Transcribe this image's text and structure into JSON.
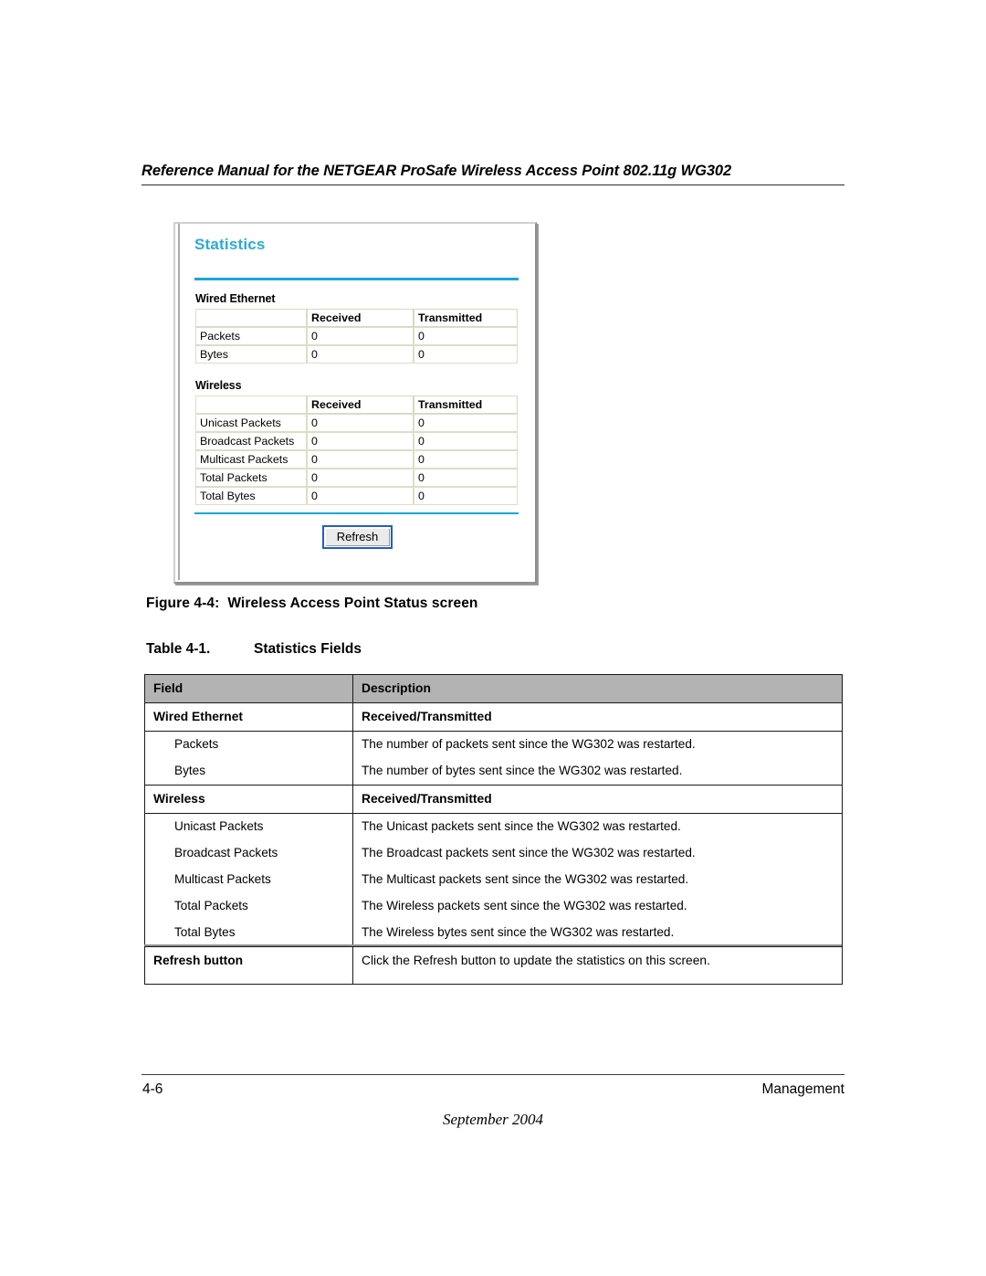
{
  "document": {
    "running_header": "Reference Manual for the NETGEAR ProSafe Wireless Access Point 802.11g WG302",
    "footer": {
      "page_number": "4-6",
      "chapter": "Management",
      "date": "September 2004"
    }
  },
  "figure": {
    "caption_number": "Figure 4-4:",
    "caption_text": "Wireless Access Point Status screen",
    "screen": {
      "title": "Statistics",
      "accent_color": "#19a8d8",
      "sections": [
        {
          "label": "Wired Ethernet",
          "columns": [
            "",
            "Received",
            "Transmitted"
          ],
          "rows": [
            {
              "name": "Packets",
              "received": "0",
              "transmitted": "0"
            },
            {
              "name": "Bytes",
              "received": "0",
              "transmitted": "0"
            }
          ]
        },
        {
          "label": "Wireless",
          "columns": [
            "",
            "Received",
            "Transmitted"
          ],
          "rows": [
            {
              "name": "Unicast Packets",
              "received": "0",
              "transmitted": "0"
            },
            {
              "name": "Broadcast Packets",
              "received": "0",
              "transmitted": "0"
            },
            {
              "name": "Multicast Packets",
              "received": "0",
              "transmitted": "0"
            },
            {
              "name": "Total Packets",
              "received": "0",
              "transmitted": "0"
            },
            {
              "name": "Total Bytes",
              "received": "0",
              "transmitted": "0"
            }
          ]
        }
      ],
      "refresh_button_label": "Refresh"
    }
  },
  "table": {
    "caption_number": "Table 4-1.",
    "caption_text": "Statistics Fields",
    "header": {
      "field": "Field",
      "description": "Description"
    },
    "groups": [
      {
        "field": "Wired Ethernet",
        "description": "Received/Transmitted",
        "items": [
          {
            "field": "Packets",
            "description": "The number of packets sent since the WG302 was restarted."
          },
          {
            "field": "Bytes",
            "description": "The number of bytes sent since the WG302 was restarted."
          }
        ]
      },
      {
        "field": "Wireless",
        "description": "Received/Transmitted",
        "items": [
          {
            "field": "Unicast Packets",
            "description": "The Unicast packets sent since the WG302 was restarted."
          },
          {
            "field": "Broadcast Packets",
            "description": "The Broadcast packets sent since the WG302 was restarted."
          },
          {
            "field": "Multicast Packets",
            "description": "The Multicast packets sent since the WG302 was restarted."
          },
          {
            "field": "Total Packets",
            "description": "The Wireless packets sent since the WG302 was restarted."
          },
          {
            "field": "Total Bytes",
            "description": "The Wireless bytes sent since the WG302 was restarted."
          }
        ]
      }
    ],
    "footer_row": {
      "field": "Refresh button",
      "description": "Click the Refresh button to update the statistics on this screen."
    }
  }
}
